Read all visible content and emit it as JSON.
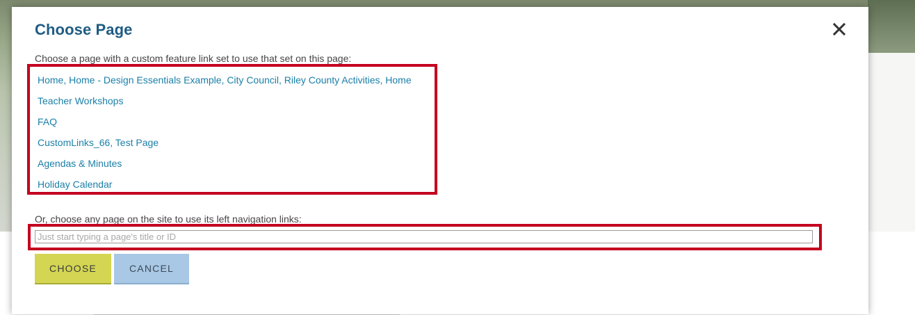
{
  "modal": {
    "title": "Choose Page",
    "close_label": "close",
    "instruction_links": "Choose a page with a custom feature link set to use that set on this page:",
    "link_sets": [
      "Home, Home - Design Essentials Example, City Council, Riley County Activities, Home",
      "Teacher Workshops",
      "FAQ",
      "CustomLinks_66, Test Page",
      "Agendas & Minutes",
      "Holiday Calendar"
    ],
    "instruction_search": "Or, choose any page on the site to use its left navigation links:",
    "search": {
      "value": "",
      "placeholder": "Just start typing a page's title or ID"
    },
    "buttons": {
      "choose": "CHOOSE",
      "cancel": "CANCEL"
    }
  },
  "colors": {
    "title": "#1f5c84",
    "link": "#1a7fa8",
    "highlight_border": "#c4001f",
    "choose_button": "#d4d653",
    "cancel_button": "#a9c8e5"
  },
  "icons": {
    "close": "close-icon"
  }
}
